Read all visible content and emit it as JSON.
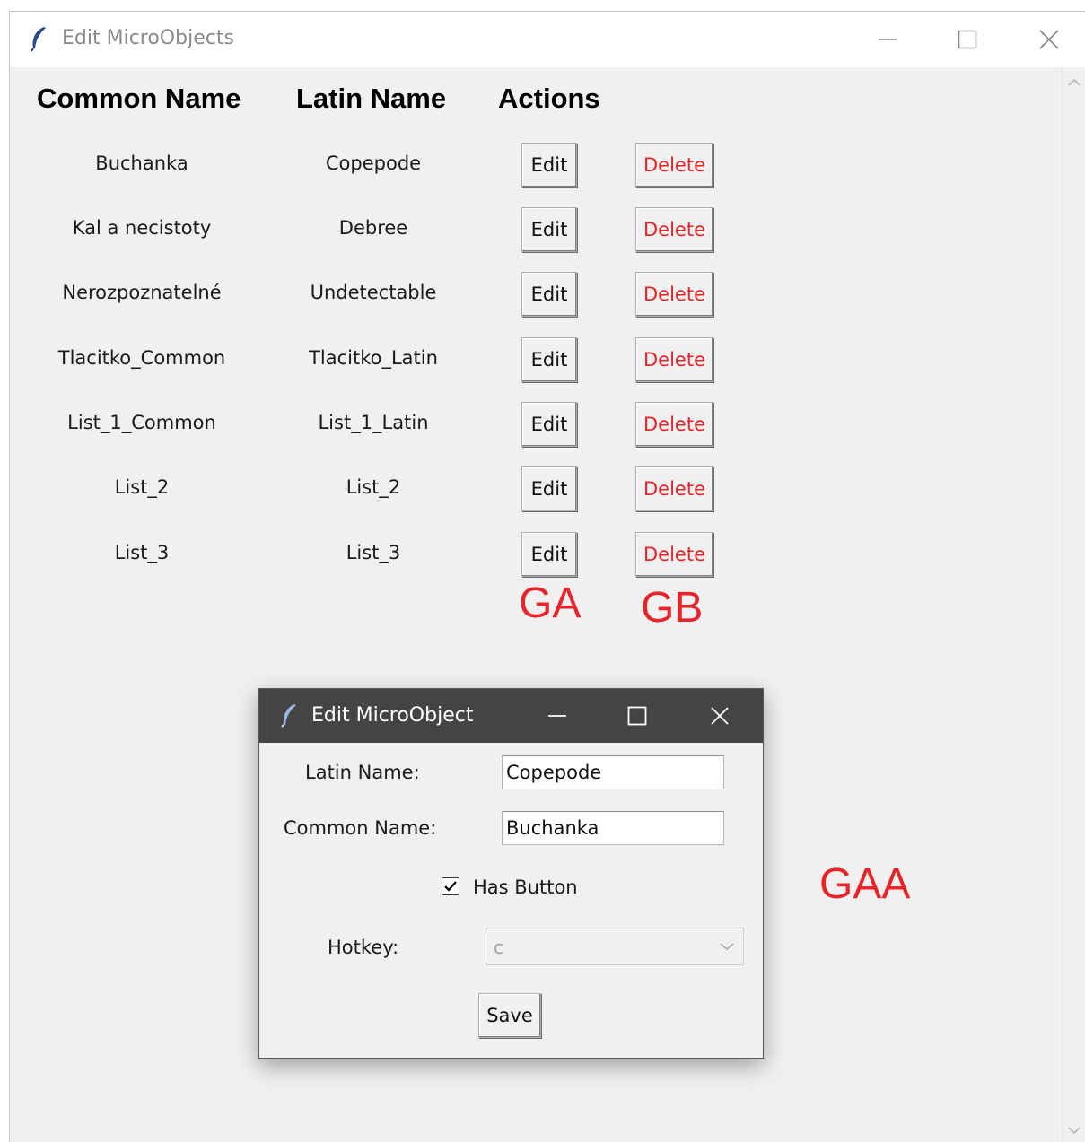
{
  "window": {
    "title": "Edit MicroObjects"
  },
  "table": {
    "headers": [
      "Common Name",
      "Latin Name",
      "Actions"
    ],
    "rows": [
      {
        "common": "Buchanka",
        "latin": "Copepode",
        "edit": "Edit",
        "delete": "Delete"
      },
      {
        "common": "Kal a necistoty",
        "latin": "Debree",
        "edit": "Edit",
        "delete": "Delete"
      },
      {
        "common": "Nerozpoznatelné",
        "latin": "Undetectable",
        "edit": "Edit",
        "delete": "Delete"
      },
      {
        "common": "Tlacitko_Common",
        "latin": "Tlacitko_Latin",
        "edit": "Edit",
        "delete": "Delete"
      },
      {
        "common": "List_1_Common",
        "latin": "List_1_Latin",
        "edit": "Edit",
        "delete": "Delete"
      },
      {
        "common": "List_2",
        "latin": "List_2",
        "edit": "Edit",
        "delete": "Delete"
      },
      {
        "common": "List_3",
        "latin": "List_3",
        "edit": "Edit",
        "delete": "Delete"
      }
    ]
  },
  "annotations": {
    "ga": "GA",
    "gb": "GB",
    "gaa": "GAA",
    "color": "#e8242a"
  },
  "dialog": {
    "title": "Edit MicroObject",
    "latin_label": "Latin Name:",
    "latin_value": "Copepode",
    "common_label": "Common Name:",
    "common_value": "Buchanka",
    "has_button_label": "Has Button",
    "has_button_checked": true,
    "hotkey_label": "Hotkey:",
    "hotkey_value": "c",
    "save_label": "Save"
  },
  "icons": {
    "app": "feather-icon",
    "minimize": "minimize-icon",
    "maximize": "maximize-icon",
    "close": "close-icon"
  }
}
